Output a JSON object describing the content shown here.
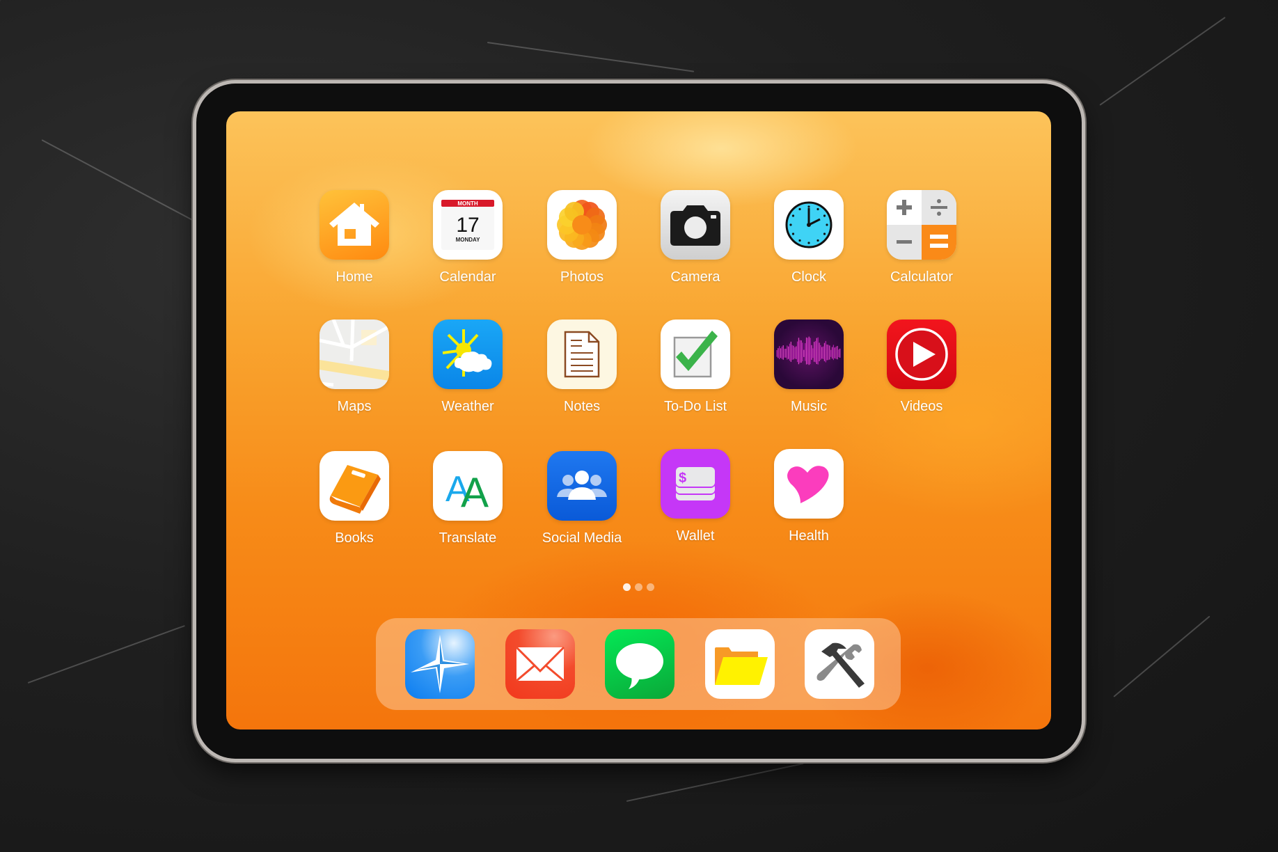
{
  "home_screen": {
    "apps": [
      {
        "label": "Home",
        "icon": "house-icon"
      },
      {
        "label": "Calendar",
        "icon": "calendar-icon",
        "month": "MONTH",
        "day": "17",
        "weekday": "MONDAY"
      },
      {
        "label": "Photos",
        "icon": "photos-flower-icon"
      },
      {
        "label": "Camera",
        "icon": "camera-icon"
      },
      {
        "label": "Clock",
        "icon": "clock-icon"
      },
      {
        "label": "Calculator",
        "icon": "calculator-icon"
      },
      {
        "label": "Maps",
        "icon": "map-icon"
      },
      {
        "label": "Weather",
        "icon": "sun-cloud-icon"
      },
      {
        "label": "Notes",
        "icon": "document-icon"
      },
      {
        "label": "To-Do List",
        "icon": "checkbox-check-icon"
      },
      {
        "label": "Music",
        "icon": "sound-wave-icon"
      },
      {
        "label": "Videos",
        "icon": "play-icon"
      },
      {
        "label": "Books",
        "icon": "book-icon"
      },
      {
        "label": "Translate",
        "icon": "translate-aa-icon",
        "glyphs": "AA"
      },
      {
        "label": "Social Media",
        "icon": "people-group-icon"
      },
      {
        "label": "Wallet",
        "icon": "wallet-money-icon",
        "currency": "$"
      },
      {
        "label": "Health",
        "icon": "heart-icon"
      }
    ],
    "page_indicator": {
      "pages": 3,
      "current": 1
    }
  },
  "dock": {
    "apps": [
      {
        "name": "Compass",
        "icon": "compass-star-icon"
      },
      {
        "name": "Mail",
        "icon": "envelope-icon"
      },
      {
        "name": "Messages",
        "icon": "speech-bubble-icon"
      },
      {
        "name": "Files",
        "icon": "folder-icon"
      },
      {
        "name": "Tools",
        "icon": "hammer-wrench-icon"
      }
    ]
  },
  "colors": {
    "wallpaper_top": "#fcc35a",
    "wallpaper_bottom": "#f4750c",
    "device_bezel": "#0e0e0e",
    "device_rim": "#bdb8b4"
  }
}
